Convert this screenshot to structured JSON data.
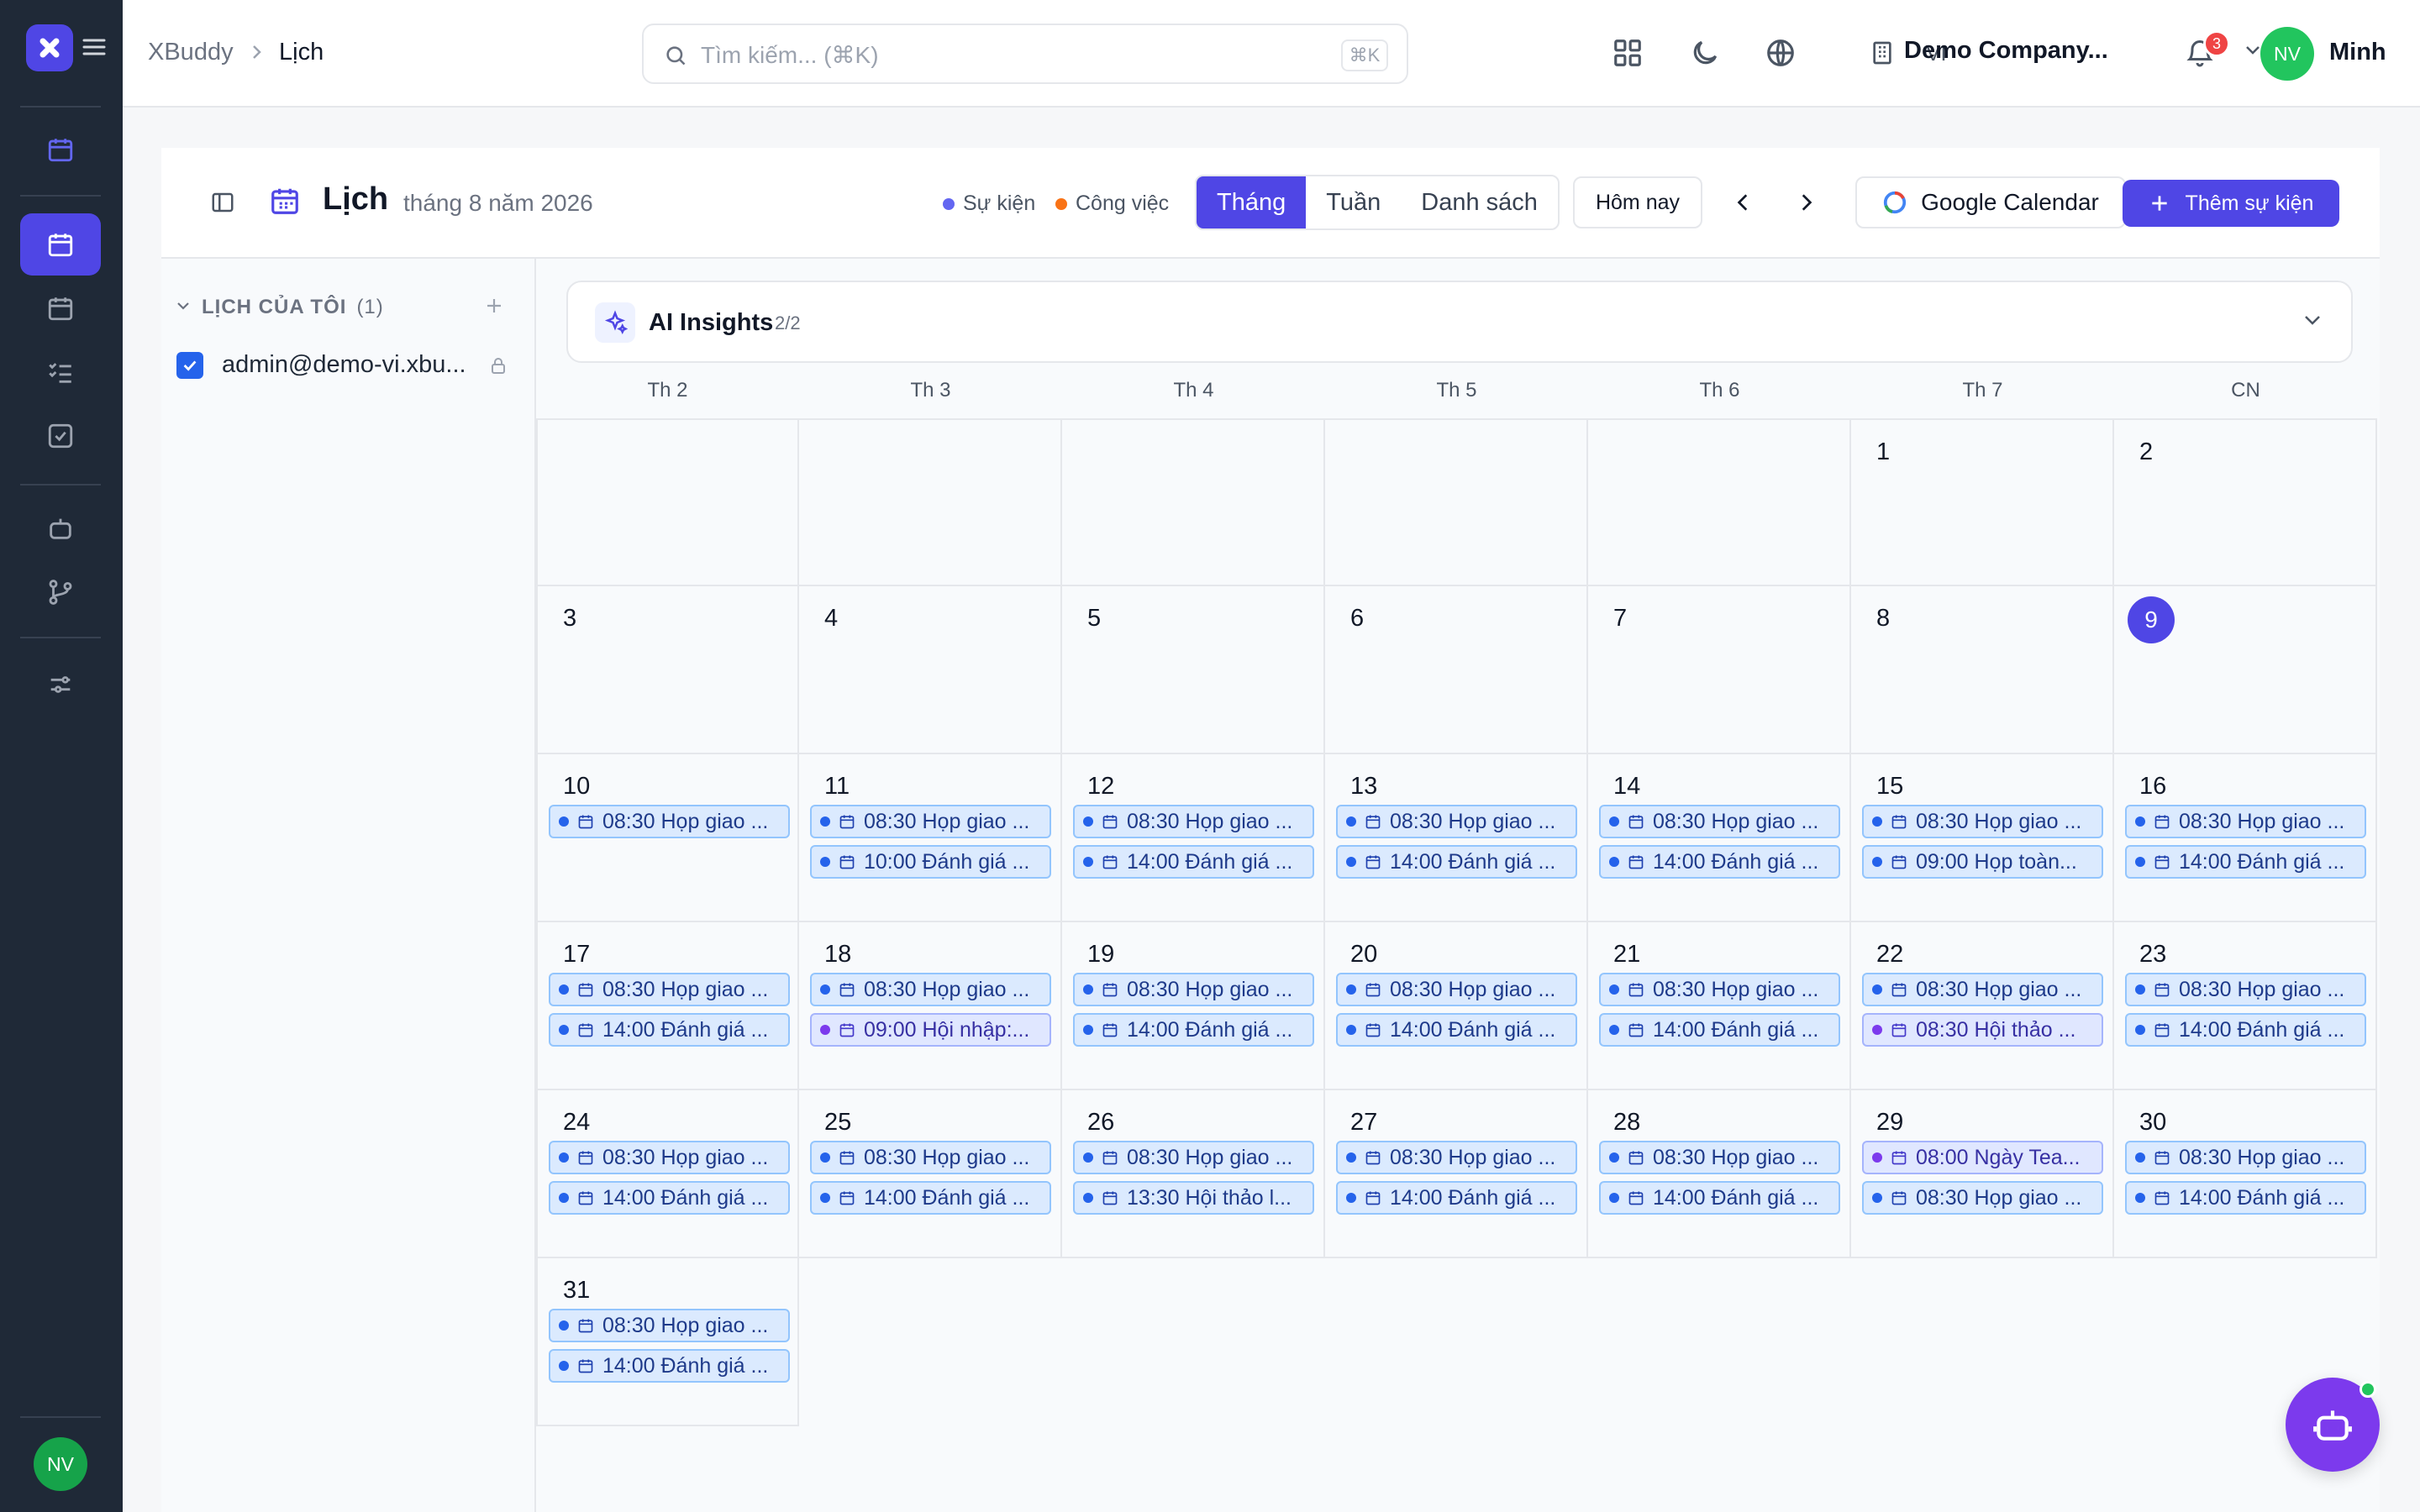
{
  "topbar": {
    "breadcrumb": [
      "XBuddy",
      "Lịch"
    ],
    "search_placeholder": "Tìm kiếm... (⌘K)",
    "search_shortcut": "⌘K",
    "language": "VI",
    "company": "Demo Company...",
    "notification_count": "3",
    "user_initials": "NV",
    "user_name": "Minh"
  },
  "rail": {
    "user_initials": "NV"
  },
  "header": {
    "title": "Lịch",
    "subtitle": "tháng 8 năm 2026",
    "legend": [
      {
        "label": "Sự kiện",
        "color": "#6366f1"
      },
      {
        "label": "Công việc",
        "color": "#f97316"
      }
    ],
    "views": [
      "Tháng",
      "Tuần",
      "Danh sách"
    ],
    "active_view": "Tháng",
    "today_label": "Hôm nay",
    "google_label": "Google Calendar",
    "add_event_label": "Thêm sự kiện"
  },
  "sidebar": {
    "section_title": "LỊCH CỦA TÔI",
    "section_count": "(1)",
    "calendars": [
      {
        "label": "admin@demo-vi.xbu...",
        "checked": true
      }
    ]
  },
  "ai_insights": {
    "title": "AI Insights",
    "count": "2/2"
  },
  "weekdays": [
    "Th 2",
    "Th 3",
    "Th 4",
    "Th 5",
    "Th 6",
    "Th 7",
    "CN"
  ],
  "today": 9,
  "weeks": [
    [
      {
        "day": ""
      },
      {
        "day": ""
      },
      {
        "day": ""
      },
      {
        "day": ""
      },
      {
        "day": ""
      },
      {
        "day": "1"
      },
      {
        "day": "2"
      }
    ],
    [
      {
        "day": "3"
      },
      {
        "day": "4"
      },
      {
        "day": "5"
      },
      {
        "day": "6"
      },
      {
        "day": "7"
      },
      {
        "day": "8"
      },
      {
        "day": "9"
      }
    ],
    [
      {
        "day": "10",
        "events": [
          {
            "text": "08:30 Họp giao ...",
            "type": "event"
          }
        ]
      },
      {
        "day": "11",
        "events": [
          {
            "text": "08:30 Họp giao ...",
            "type": "event"
          },
          {
            "text": "10:00 Đánh giá ...",
            "type": "event"
          }
        ]
      },
      {
        "day": "12",
        "events": [
          {
            "text": "08:30 Họp giao ...",
            "type": "event"
          },
          {
            "text": "14:00 Đánh giá ...",
            "type": "event"
          }
        ]
      },
      {
        "day": "13",
        "events": [
          {
            "text": "08:30 Họp giao ...",
            "type": "event"
          },
          {
            "text": "14:00 Đánh giá ...",
            "type": "event"
          }
        ]
      },
      {
        "day": "14",
        "events": [
          {
            "text": "08:30 Họp giao ...",
            "type": "event"
          },
          {
            "text": "14:00 Đánh giá ...",
            "type": "event"
          }
        ]
      },
      {
        "day": "15",
        "events": [
          {
            "text": "08:30 Họp giao ...",
            "type": "event"
          },
          {
            "text": "09:00 Họp toàn...",
            "type": "event"
          }
        ]
      },
      {
        "day": "16",
        "events": [
          {
            "text": "08:30 Họp giao ...",
            "type": "event"
          },
          {
            "text": "14:00 Đánh giá ...",
            "type": "event"
          }
        ]
      }
    ],
    [
      {
        "day": "17",
        "events": [
          {
            "text": "08:30 Họp giao ...",
            "type": "event"
          },
          {
            "text": "14:00 Đánh giá ...",
            "type": "event"
          }
        ]
      },
      {
        "day": "18",
        "events": [
          {
            "text": "08:30 Họp giao ...",
            "type": "event"
          },
          {
            "text": "09:00 Hội nhập:...",
            "type": "purple"
          }
        ]
      },
      {
        "day": "19",
        "events": [
          {
            "text": "08:30 Họp giao ...",
            "type": "event"
          },
          {
            "text": "14:00 Đánh giá ...",
            "type": "event"
          }
        ]
      },
      {
        "day": "20",
        "events": [
          {
            "text": "08:30 Họp giao ...",
            "type": "event"
          },
          {
            "text": "14:00 Đánh giá ...",
            "type": "event"
          }
        ]
      },
      {
        "day": "21",
        "events": [
          {
            "text": "08:30 Họp giao ...",
            "type": "event"
          },
          {
            "text": "14:00 Đánh giá ...",
            "type": "event"
          }
        ]
      },
      {
        "day": "22",
        "events": [
          {
            "text": "08:30 Họp giao ...",
            "type": "event"
          },
          {
            "text": "08:30 Hội thảo ...",
            "type": "purple"
          }
        ]
      },
      {
        "day": "23",
        "events": [
          {
            "text": "08:30 Họp giao ...",
            "type": "event"
          },
          {
            "text": "14:00 Đánh giá ...",
            "type": "event"
          }
        ]
      }
    ],
    [
      {
        "day": "24",
        "events": [
          {
            "text": "08:30 Họp giao ...",
            "type": "event"
          },
          {
            "text": "14:00 Đánh giá ...",
            "type": "event"
          }
        ]
      },
      {
        "day": "25",
        "events": [
          {
            "text": "08:30 Họp giao ...",
            "type": "event"
          },
          {
            "text": "14:00 Đánh giá ...",
            "type": "event"
          }
        ]
      },
      {
        "day": "26",
        "events": [
          {
            "text": "08:30 Họp giao ...",
            "type": "event"
          },
          {
            "text": "13:30 Hội thảo l...",
            "type": "event"
          }
        ]
      },
      {
        "day": "27",
        "events": [
          {
            "text": "08:30 Họp giao ...",
            "type": "event"
          },
          {
            "text": "14:00 Đánh giá ...",
            "type": "event"
          }
        ]
      },
      {
        "day": "28",
        "events": [
          {
            "text": "08:30 Họp giao ...",
            "type": "event"
          },
          {
            "text": "14:00 Đánh giá ...",
            "type": "event"
          }
        ]
      },
      {
        "day": "29",
        "events": [
          {
            "text": "08:00 Ngày Tea...",
            "type": "purple"
          },
          {
            "text": "08:30 Họp giao ...",
            "type": "event"
          }
        ]
      },
      {
        "day": "30",
        "events": [
          {
            "text": "08:30 Họp giao ...",
            "type": "event"
          },
          {
            "text": "14:00 Đánh giá ...",
            "type": "event"
          }
        ]
      }
    ],
    [
      {
        "day": "31",
        "events": [
          {
            "text": "08:30 Họp giao ...",
            "type": "event"
          },
          {
            "text": "14:00 Đánh giá ...",
            "type": "event"
          }
        ]
      }
    ]
  ]
}
